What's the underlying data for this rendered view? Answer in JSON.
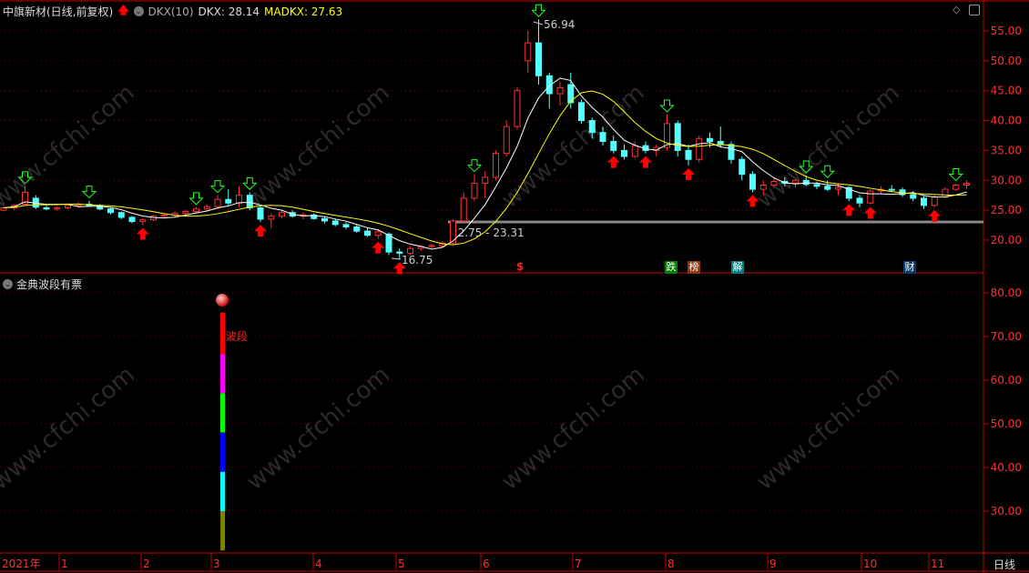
{
  "header": {
    "stock_name": "中旗新材(日线,前复权)",
    "indicator": "DKX(10)",
    "dkx_label": "DKX: 28.14",
    "madkx_label": "MADKX: 27.63"
  },
  "lower_panel": {
    "title": "金典波段有票",
    "bar_label": "波段"
  },
  "watermark": "www.cfchi.com",
  "period_label": "日线",
  "badges": [
    {
      "text": "跌",
      "color": "#008000"
    },
    {
      "text": "榜",
      "color": "#8b3a10"
    },
    {
      "text": "解",
      "color": "#008080"
    },
    {
      "text": "财",
      "color": "#0a3a6e"
    }
  ],
  "dollar_marker": "$",
  "colors": {
    "up": "#ff3030",
    "down": "#54ffff",
    "dkx": "#ffffff",
    "madkx": "#ffff00",
    "axis": "#c00000"
  },
  "chart_data": [
    {
      "type": "candlestick",
      "title": "中旗新材(日线,前复权)",
      "ylim": [
        15,
        58
      ],
      "y_ticks": [
        "55.00",
        "50.00",
        "45.00",
        "40.00",
        "35.00",
        "30.00",
        "25.00",
        "20.00"
      ],
      "y_tick_values": [
        55,
        50,
        45,
        40,
        35,
        30,
        25,
        20
      ],
      "x_ticks": [
        "2021年",
        "1",
        "2",
        "3",
        "4",
        "5",
        "6",
        "7",
        "8",
        "9",
        "10",
        "11"
      ],
      "ohlc": [
        [
          25.0,
          25.6,
          24.8,
          25.4
        ],
        [
          25.4,
          26,
          25,
          25.8
        ],
        [
          26,
          29,
          25.8,
          28
        ],
        [
          27,
          27.5,
          25.2,
          25.5
        ],
        [
          25.4,
          25.8,
          25,
          25.2
        ],
        [
          25.2,
          25.6,
          24.9,
          25.4
        ],
        [
          25.4,
          26,
          25.2,
          25.8
        ],
        [
          25.8,
          26.3,
          25.4,
          26
        ],
        [
          26,
          26.6,
          25.6,
          25.8
        ],
        [
          25.8,
          26,
          25,
          25.2
        ],
        [
          25.2,
          25.4,
          24.3,
          24.6
        ],
        [
          24.6,
          24.8,
          23.5,
          23.8
        ],
        [
          23.8,
          24,
          22.8,
          23.1
        ],
        [
          23.1,
          23.6,
          22.5,
          23.4
        ],
        [
          23.4,
          24.2,
          23.2,
          24
        ],
        [
          24,
          24.5,
          23.6,
          24.2
        ],
        [
          24.2,
          24.8,
          23.9,
          24.5
        ],
        [
          24.5,
          25,
          24.2,
          24.8
        ],
        [
          24.8,
          25.5,
          24.5,
          25.2
        ],
        [
          25.2,
          26,
          24.8,
          25.6
        ],
        [
          25.6,
          27.5,
          25.2,
          26.8
        ],
        [
          26.8,
          28.5,
          25.8,
          26.2
        ],
        [
          26.2,
          29,
          25.5,
          27.5
        ],
        [
          27.5,
          28,
          25,
          25.4
        ],
        [
          25.4,
          25.8,
          23,
          23.5
        ],
        [
          23.5,
          24.5,
          22,
          24
        ],
        [
          24,
          25,
          23.6,
          24.6
        ],
        [
          24.6,
          25,
          23.8,
          24
        ],
        [
          24,
          24.6,
          23.5,
          24.2
        ],
        [
          24.2,
          24.5,
          23.4,
          23.6
        ],
        [
          23.6,
          24,
          22.8,
          23.2
        ],
        [
          23.2,
          23.5,
          22.3,
          22.6
        ],
        [
          22.6,
          23,
          21.8,
          22.2
        ],
        [
          22.2,
          22.6,
          21.2,
          21.5
        ],
        [
          21.5,
          22,
          20.5,
          20.8
        ],
        [
          20.8,
          21.8,
          20.2,
          21.4
        ],
        [
          21,
          21.3,
          17.5,
          18
        ],
        [
          18,
          18.6,
          16.75,
          17.8
        ],
        [
          17.8,
          19,
          17.5,
          18.6
        ],
        [
          18.6,
          19.2,
          18.2,
          18.9
        ],
        [
          18.9,
          19.4,
          18.6,
          19.1
        ],
        [
          19,
          19.8,
          18.8,
          19.5
        ],
        [
          19.5,
          23.5,
          19.3,
          23.2
        ],
        [
          23.2,
          28,
          23,
          27
        ],
        [
          27,
          31,
          26.5,
          29.5
        ],
        [
          29.5,
          31.5,
          27,
          30.5
        ],
        [
          30.5,
          35,
          30,
          34.5
        ],
        [
          34.5,
          40,
          34,
          39
        ],
        [
          39,
          45.5,
          38.5,
          45
        ],
        [
          50,
          55,
          48,
          53
        ],
        [
          53,
          56.94,
          46,
          47.5
        ],
        [
          47.5,
          48,
          42,
          44.5
        ],
        [
          44.5,
          46.5,
          42.5,
          45.5
        ],
        [
          46,
          48,
          42,
          43
        ],
        [
          43,
          43.5,
          39.5,
          40
        ],
        [
          40,
          40.5,
          37,
          38
        ],
        [
          38,
          39,
          35.8,
          36.5
        ],
        [
          36.5,
          37.5,
          34.5,
          35
        ],
        [
          35,
          36,
          33.5,
          34
        ],
        [
          34,
          36.5,
          33.8,
          35.8
        ],
        [
          35.8,
          36.5,
          34.5,
          35
        ],
        [
          35,
          36,
          34,
          35.5
        ],
        [
          35.5,
          41,
          35,
          39.5
        ],
        [
          39.5,
          40,
          34,
          35
        ],
        [
          35,
          36,
          32.5,
          33.5
        ],
        [
          33.5,
          37.5,
          33,
          37
        ],
        [
          37,
          38,
          35.5,
          36.5
        ],
        [
          36.5,
          39,
          35.5,
          36
        ],
        [
          36,
          36.5,
          32.8,
          33.5
        ],
        [
          33.5,
          34,
          30,
          31
        ],
        [
          31,
          31.5,
          28,
          28.5
        ],
        [
          28.5,
          30,
          27.5,
          29.2
        ],
        [
          29.2,
          30.5,
          28.8,
          29.8
        ],
        [
          29.8,
          30.5,
          29,
          29.5
        ],
        [
          29.5,
          30.2,
          28.8,
          30
        ],
        [
          30,
          30.8,
          29,
          29.3
        ],
        [
          29.3,
          29.8,
          28.5,
          29
        ],
        [
          29,
          30,
          28.2,
          28.5
        ],
        [
          28.5,
          29.5,
          27.5,
          28.8
        ],
        [
          28.8,
          29,
          26.5,
          27
        ],
        [
          27,
          27.5,
          25.5,
          26.2
        ],
        [
          26.2,
          28.5,
          26,
          28.2
        ],
        [
          28.2,
          29,
          27.8,
          28.5
        ],
        [
          28.5,
          29.2,
          28,
          28.4
        ],
        [
          28.4,
          28.8,
          27.2,
          27.6
        ],
        [
          27.6,
          28.2,
          26.5,
          27
        ],
        [
          27,
          27.5,
          25.2,
          25.8
        ],
        [
          25.8,
          27.5,
          25.5,
          27.2
        ],
        [
          27.2,
          28.8,
          27,
          28.5
        ],
        [
          28.5,
          29.5,
          28.2,
          29.2
        ],
        [
          29.2,
          30,
          28.6,
          29.5
        ]
      ],
      "series": [
        {
          "name": "DKX",
          "last": 28.14
        },
        {
          "name": "MADKX",
          "last": 27.63
        }
      ],
      "sell_arrows": [
        2,
        8,
        18,
        20,
        23,
        44,
        50,
        62,
        75,
        77,
        89
      ],
      "buy_arrows": [
        13,
        24,
        35,
        37,
        57,
        60,
        64,
        70,
        79,
        81,
        87
      ],
      "high_label": "56.94",
      "low_label": "16.75",
      "level_line": 23.03,
      "level_label": "22.75 - 23.31"
    },
    {
      "type": "bar",
      "title": "金典波段有票",
      "ylim": [
        25,
        83
      ],
      "y_ticks": [
        "80.00",
        "70.00",
        "60.00",
        "50.00",
        "40.00",
        "30.00"
      ],
      "y_tick_values": [
        80,
        70,
        60,
        50,
        40,
        30
      ],
      "segments": [
        {
          "from": 66,
          "to": 75.5,
          "color": "#ff0000"
        },
        {
          "from": 57,
          "to": 66,
          "color": "#ff00ff"
        },
        {
          "from": 48,
          "to": 57,
          "color": "#00ff00"
        },
        {
          "from": 39,
          "to": 48,
          "color": "#0000ff"
        },
        {
          "from": 30,
          "to": 39,
          "color": "#00ffff"
        },
        {
          "from": 21,
          "to": 30,
          "color": "#808000"
        }
      ]
    }
  ]
}
